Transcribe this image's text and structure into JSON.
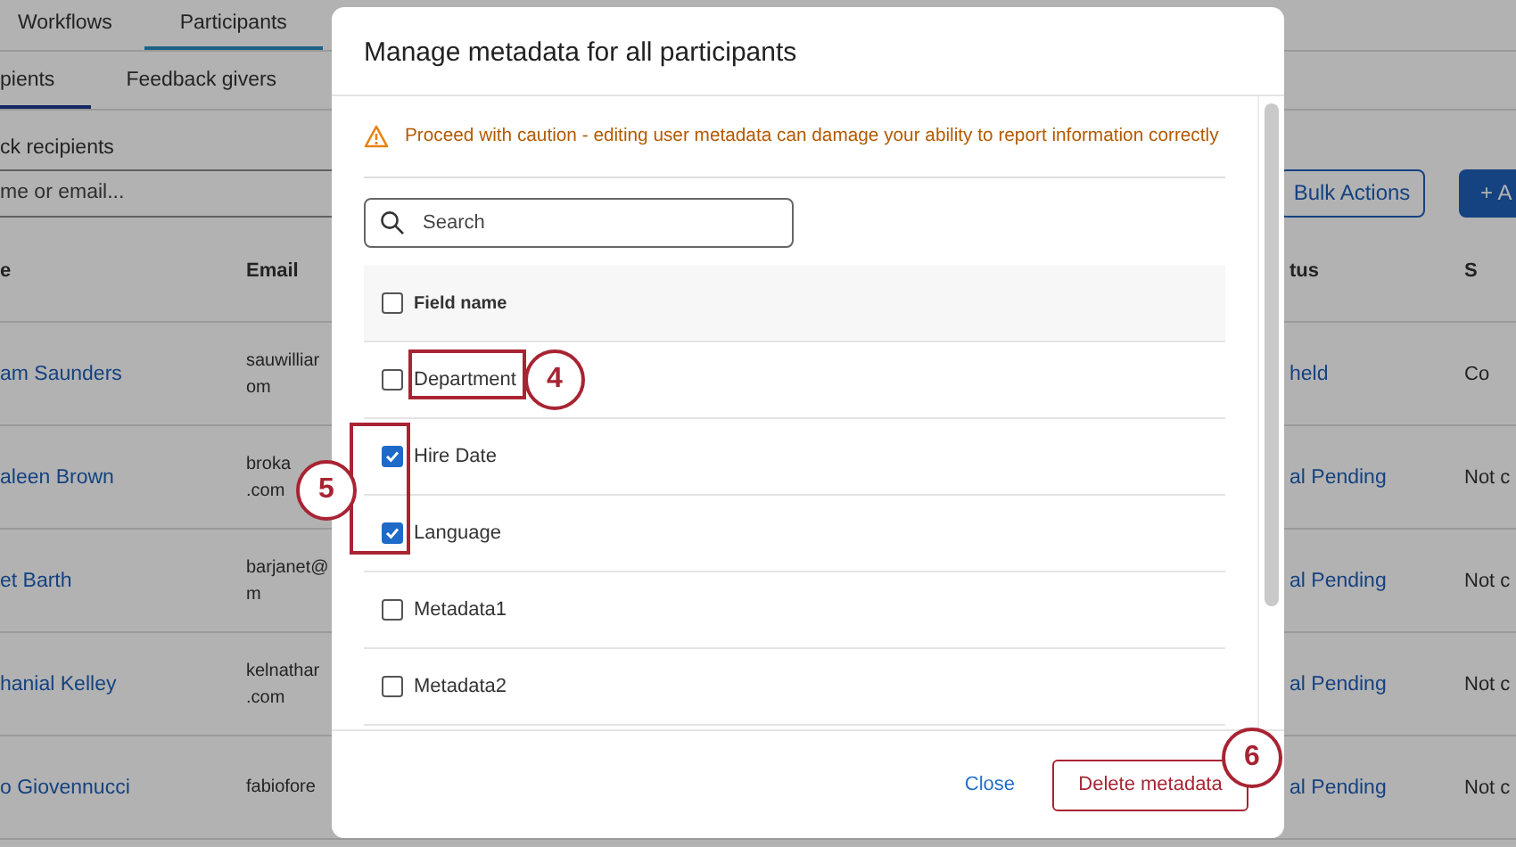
{
  "top_tabs": [
    {
      "label": "Workflows",
      "selected": false
    },
    {
      "label": "Participants",
      "selected": true
    }
  ],
  "sub_tabs": [
    {
      "label": "pients",
      "selected": true
    },
    {
      "label": "Feedback givers",
      "selected": false
    }
  ],
  "heading": "ck recipients",
  "search": {
    "placeholder": "me or email..."
  },
  "bulk_button": "Bulk Actions",
  "add_button": {
    "icon": "+",
    "label": "A"
  },
  "table": {
    "columns": [
      "e",
      "Email",
      "tus",
      "S"
    ],
    "rows": [
      {
        "name": "am Saunders",
        "email": [
          "sauwilliar",
          "om"
        ],
        "status": "held",
        "column_4": "Co"
      },
      {
        "name": "aleen Brown",
        "email": [
          "broka",
          ".com"
        ],
        "status": "al Pending",
        "column_4": "Not c"
      },
      {
        "name": "et Barth",
        "email": [
          "barjanet@",
          "m"
        ],
        "status": "al Pending",
        "column_4": "Not c"
      },
      {
        "name": "hanial Kelley",
        "email": [
          "kelnathar",
          ".com"
        ],
        "status": "al Pending",
        "column_4": "Not c"
      },
      {
        "name": "o Giovennucci",
        "email": [
          "fabiofore"
        ],
        "status": "al Pending",
        "column_4": "Not c"
      }
    ]
  },
  "modal": {
    "title": "Manage metadata for all participants",
    "warning": "Proceed with caution - editing user metadata can damage your ability to report information correctly",
    "search": {
      "placeholder": "Search"
    },
    "header": {
      "label": "Field name",
      "checked": false
    },
    "fields": [
      {
        "label": "Department",
        "checked": false
      },
      {
        "label": "Hire Date",
        "checked": true
      },
      {
        "label": "Language",
        "checked": true
      },
      {
        "label": "Metadata1",
        "checked": false
      },
      {
        "label": "Metadata2",
        "checked": false
      }
    ],
    "close": "Close",
    "delete": "Delete metadata"
  },
  "annotations": [
    {
      "number": "4"
    },
    {
      "number": "5"
    },
    {
      "number": "6"
    }
  ]
}
